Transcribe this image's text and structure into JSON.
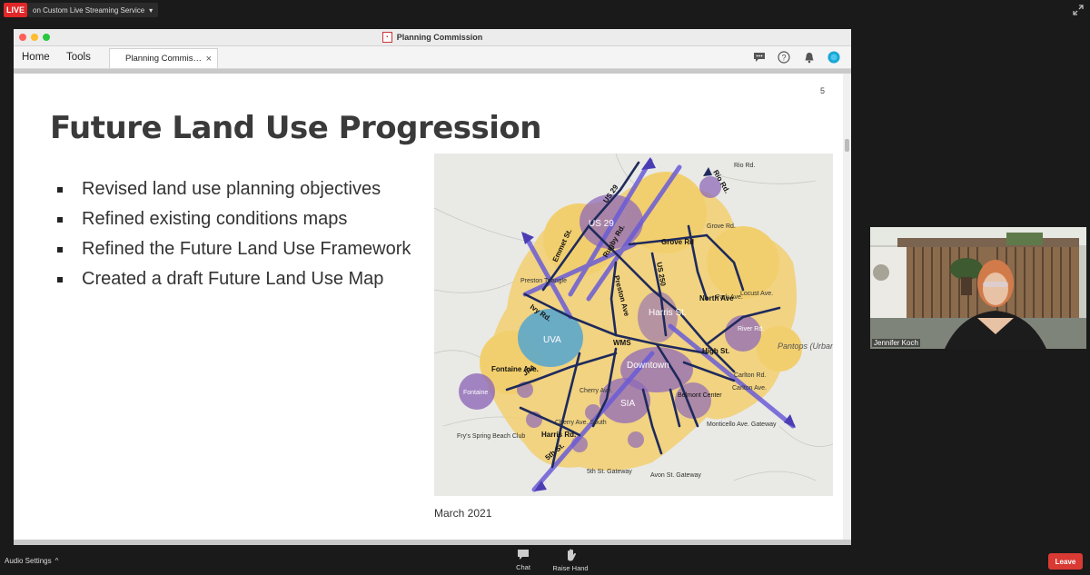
{
  "top_bar": {
    "live_label": "LIVE",
    "stream_label": "on Custom Live Streaming Service",
    "stream_chevron": "▾"
  },
  "window": {
    "title": "Planning Commission",
    "menu": [
      "Home",
      "Tools"
    ],
    "tab_label": "Planning Commis…",
    "tab_close": "×",
    "toolbar_icons": [
      "comment-icon",
      "help-icon",
      "bell-icon",
      "account-icon"
    ]
  },
  "slide": {
    "page_number": "5",
    "title": "Future Land Use Progression",
    "bullets": [
      "Revised land use planning objectives",
      "Refined existing conditions maps",
      "Refined the Future Land Use Framework",
      "Created a draft Future Land Use Map"
    ],
    "map_caption": "March 2021",
    "map_labels": {
      "us29_a": "US 29",
      "us29_b": "US 29",
      "rio": "Rio Rd.",
      "rio2": "Rio Rd.",
      "grove": "Grove Rd.",
      "grove_rd": "Grove Rd",
      "emmet": "Emmet St.",
      "rugby": "Rugby Rd.",
      "preston_ave": "Preston Ave",
      "us250": "US 250",
      "preston_triangle": "Preston Triangle",
      "ivy": "Ivy Rd.",
      "uva": "UVA",
      "harris": "Harris St.",
      "park": "Park Ave.",
      "locust": "Locust Ave.",
      "north": "North Ave",
      "river": "River Rd.",
      "pantops": "Pantops (Urban Ring)",
      "wms": "WMS",
      "downtown": "Downtown",
      "high": "High St.",
      "fontaine": "Fontaine",
      "fontaine_ave": "Fontaine Ave.",
      "jpa": "JPA",
      "cherry": "Cherry Ave.",
      "cherry_south": "Cherry Ave. South",
      "sia": "SIA",
      "belmont": "Belmont Center",
      "carlton1": "Carlton Rd.",
      "carlton2": "Carlton Ave.",
      "fry": "Fry's Spring Beach Club",
      "harris_rd": "Harris Rd.",
      "fifth": "5th St.",
      "fifth_gw": "5th St. Gateway",
      "avon_gw": "Avon St. Gateway",
      "monticello_gw": "Monticello Ave. Gateway"
    }
  },
  "video": {
    "participant_name": "Jennifer Koch"
  },
  "bottom_bar": {
    "audio_settings": "Audio Settings",
    "audio_chevron": "^",
    "chat": "Chat",
    "raise_hand": "Raise Hand",
    "leave": "Leave"
  },
  "colors": {
    "live": "#e02828",
    "leave": "#d93a33",
    "map_yellow": "#f2cf6e",
    "map_purple": "#8f69b8",
    "map_blue": "#4aa3d6",
    "road": "#1f2a5c"
  }
}
